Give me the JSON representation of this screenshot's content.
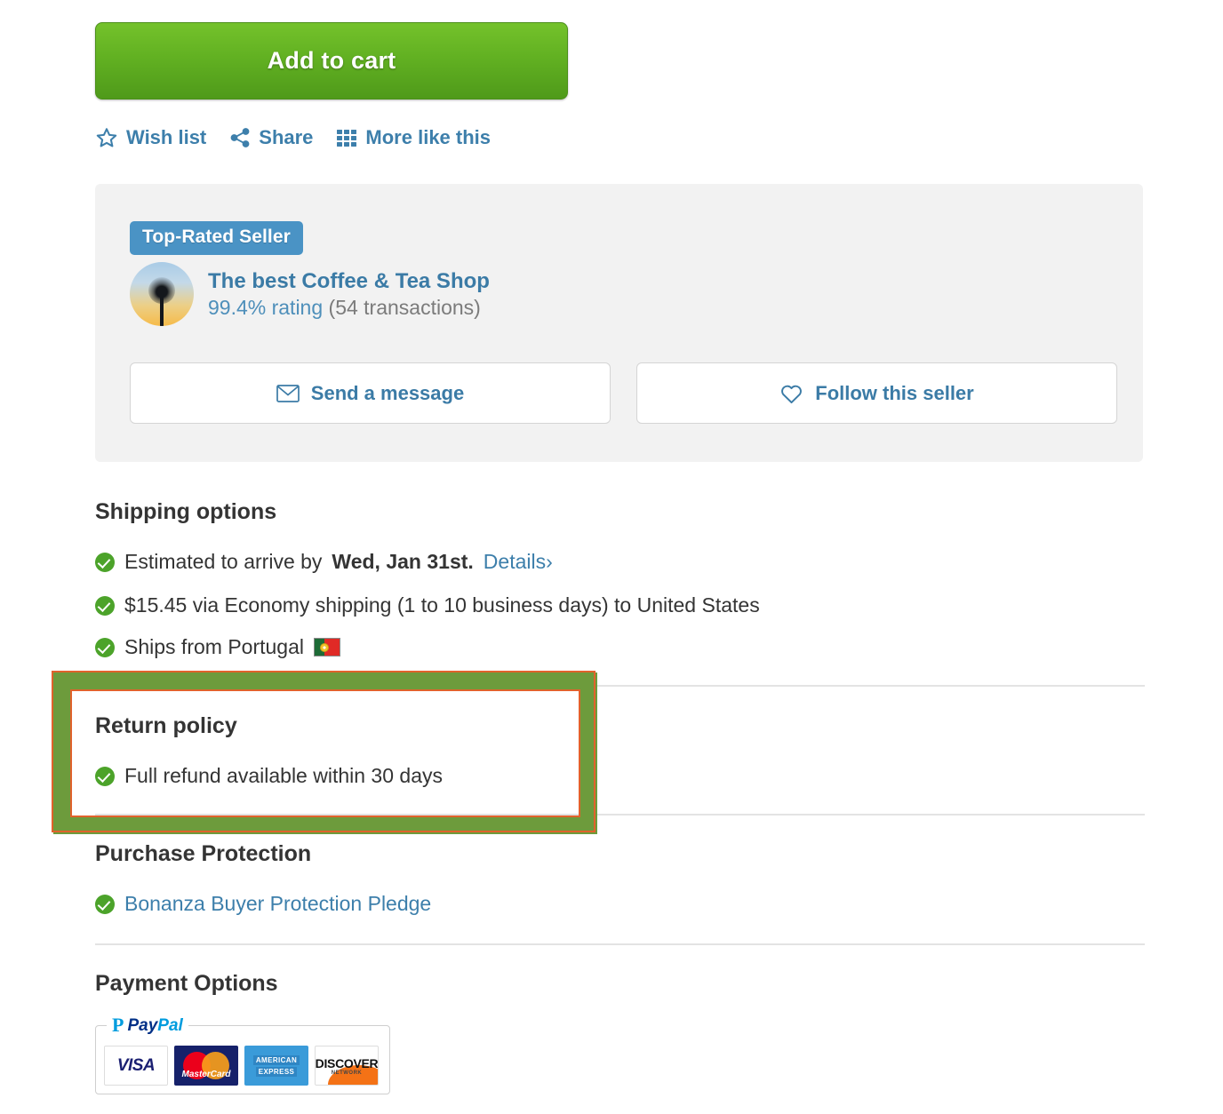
{
  "cart": {
    "add_to_cart_label": "Add to cart"
  },
  "actions": [
    {
      "label": "Wish list",
      "icon": "star-icon"
    },
    {
      "label": "Share",
      "icon": "share-icon"
    },
    {
      "label": "More like this",
      "icon": "grid-icon"
    }
  ],
  "seller": {
    "badge": "Top-Rated Seller",
    "name": "The best Coffee & Tea Shop",
    "rating_pct": "99.4% rating",
    "transactions": "(54 transactions)",
    "message_button": "Send a message",
    "follow_button": "Follow this seller"
  },
  "shipping": {
    "title": "Shipping options",
    "eta_prefix": "Estimated to arrive by",
    "eta_date": "Wed, Jan 31st.",
    "details_link": "Details",
    "details_chevron": "›",
    "cost_line": "$15.45 via Economy shipping (1 to 10 business days) to United States",
    "origin_line": "Ships from Portugal",
    "origin_flag": "portugal-flag"
  },
  "return_policy": {
    "title": "Return policy",
    "line": "Full refund available within 30 days",
    "highlight_color": "#6d9b3c",
    "highlight_inner_color": "#e1622c"
  },
  "purchase_protection": {
    "title": "Purchase Protection",
    "link": "Bonanza Buyer Protection Pledge"
  },
  "payment": {
    "title": "Payment Options",
    "paypal_mark": "P",
    "paypal_word_1": "Pay",
    "paypal_word_2": "Pal",
    "cards": [
      {
        "name": "VISA"
      },
      {
        "name": "MasterCard"
      },
      {
        "name": "AMERICAN EXPRESS",
        "line1": "AMERICAN",
        "line2": "EXPRESS"
      },
      {
        "name": "DISCOVER",
        "line1": "DISCOVER",
        "line2": "NETWORK"
      }
    ]
  },
  "colors": {
    "green_button": "#62b122",
    "link_blue": "#3d7fab",
    "check_green": "#4ca32a",
    "badge_blue": "#4a93c5",
    "card_bg": "#f2f2f2"
  }
}
